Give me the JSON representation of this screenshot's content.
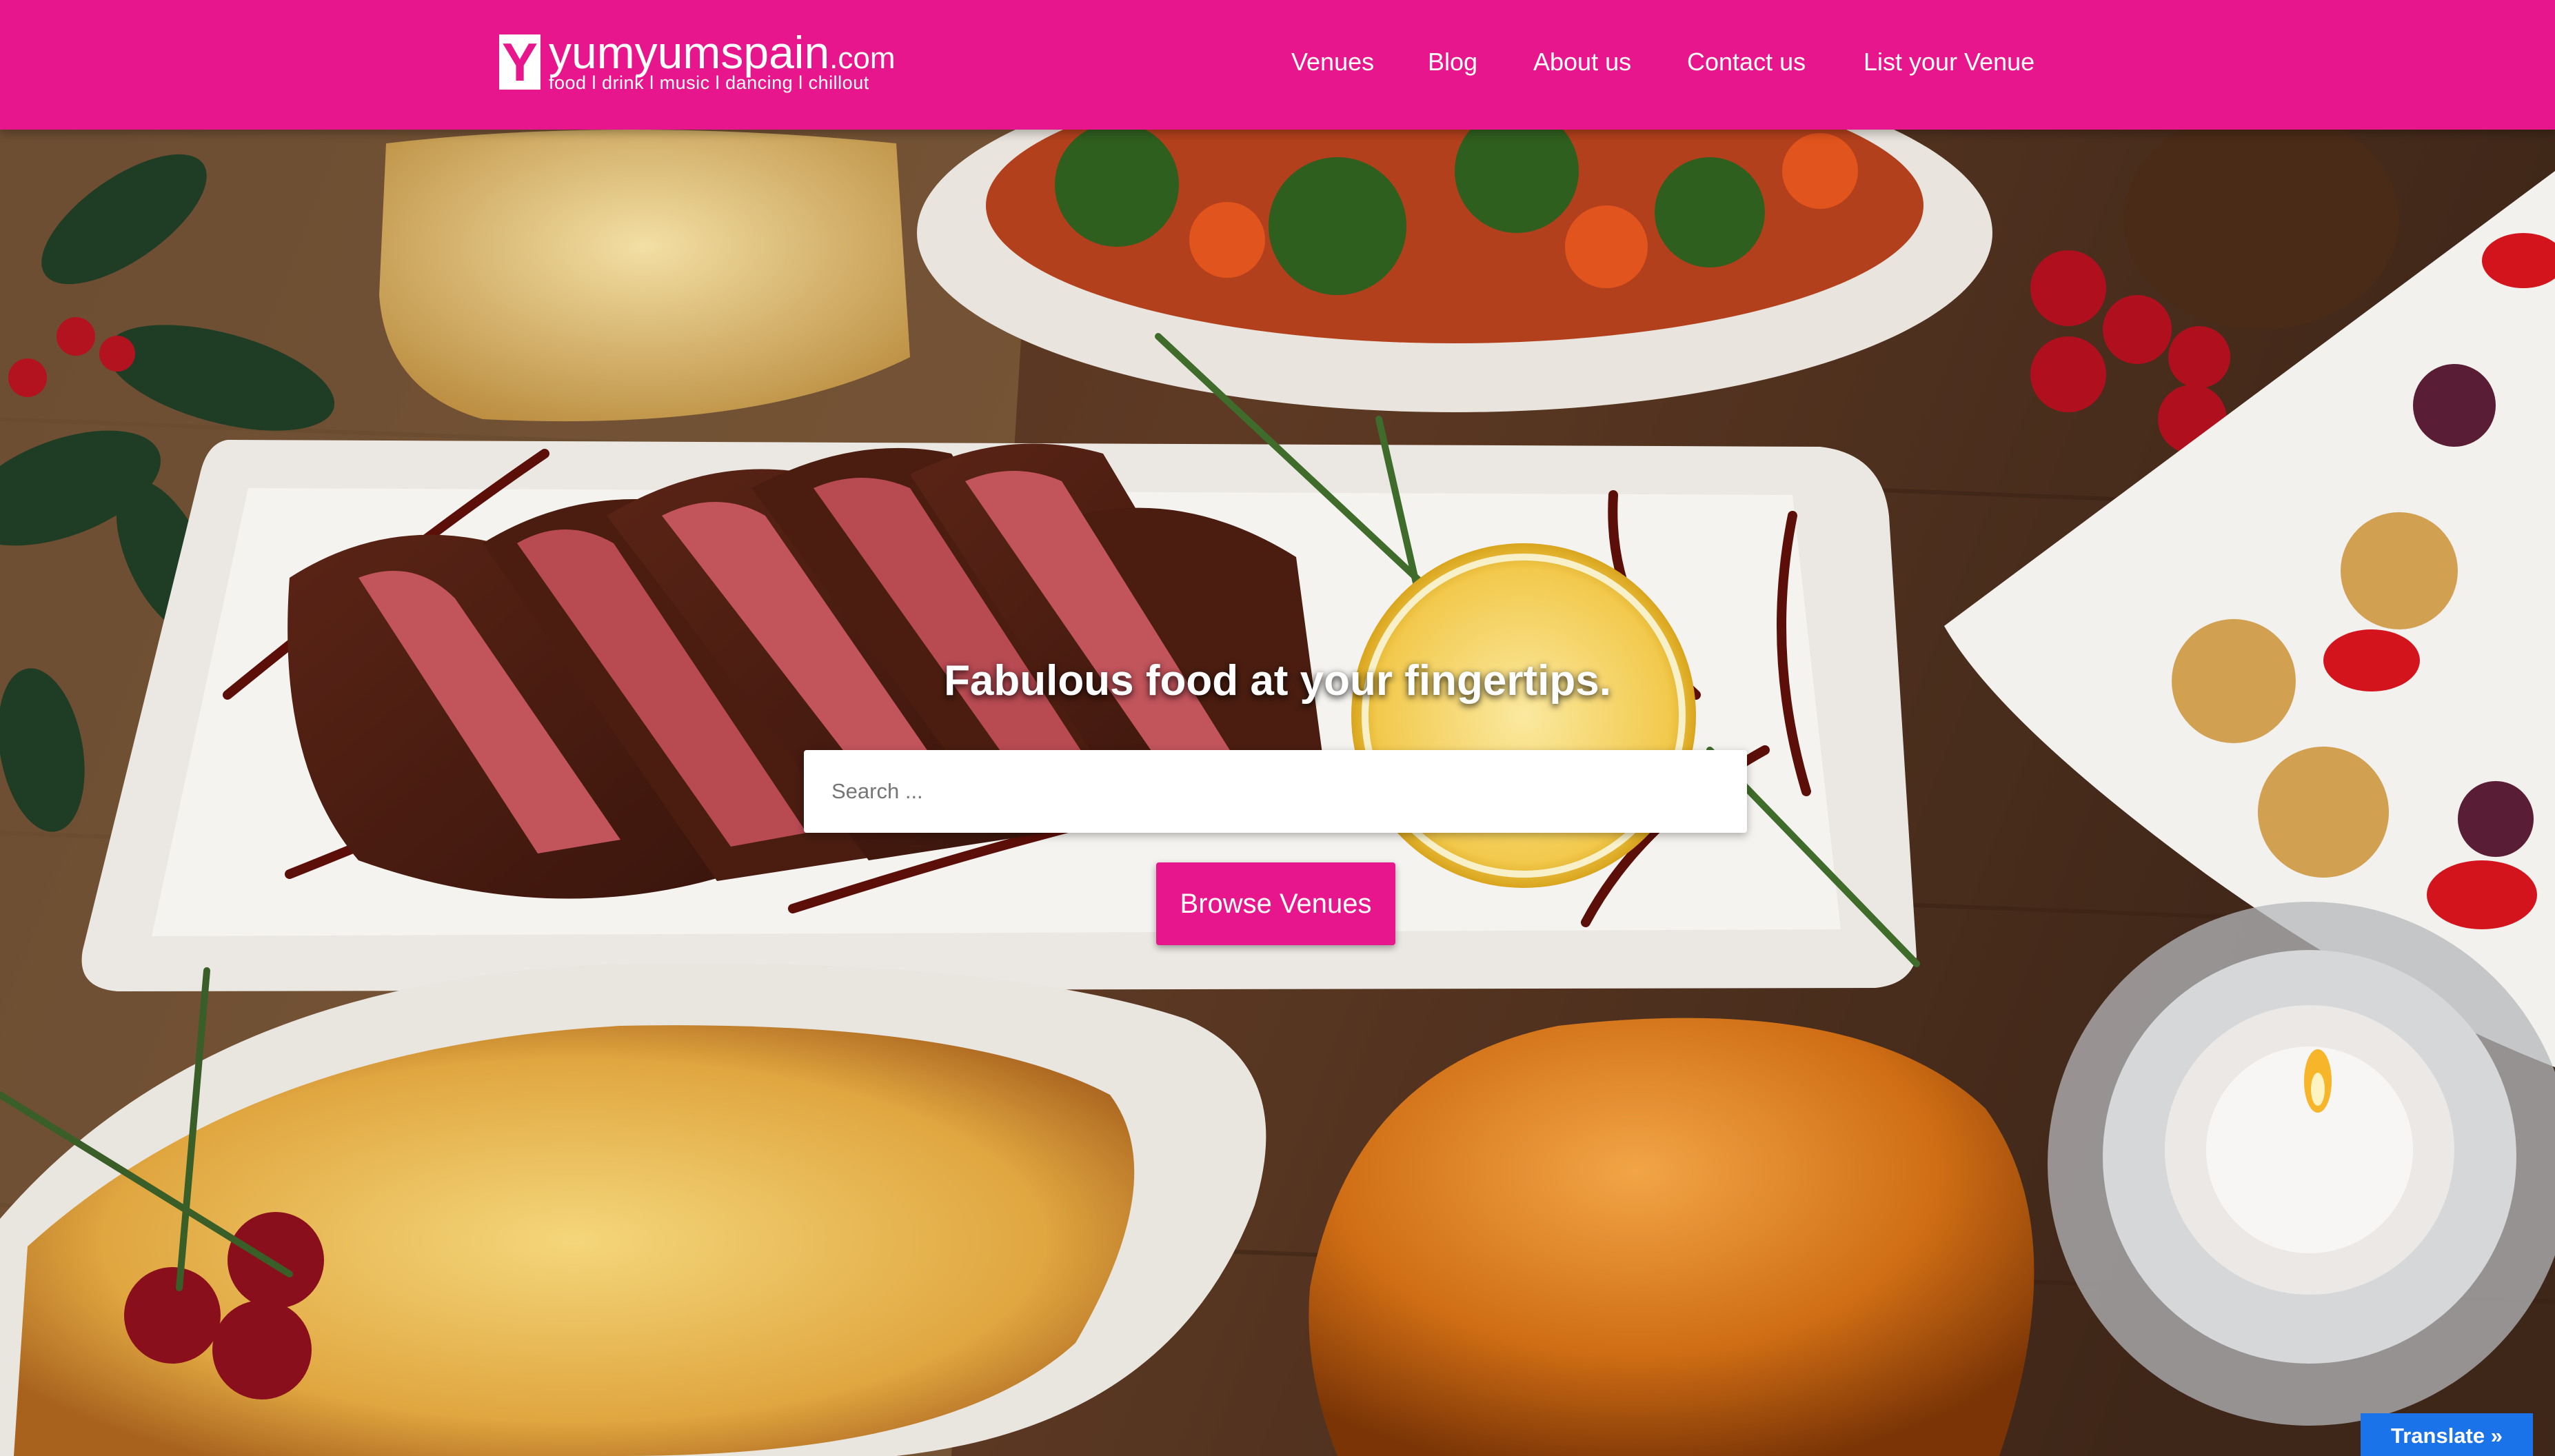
{
  "brand": {
    "logo_letter": "Y",
    "name": "yumyumspain",
    "tld": ".com",
    "tagline": "food  l drink  l music  l dancing  l chillout",
    "accent_color": "#e8168c"
  },
  "nav": {
    "items": [
      {
        "label": "Venues"
      },
      {
        "label": "Blog"
      },
      {
        "label": "About us"
      },
      {
        "label": "Contact us"
      },
      {
        "label": "List your Venue"
      }
    ]
  },
  "hero": {
    "headline": "Fabulous food at your fingertips.",
    "search": {
      "value": "",
      "placeholder": "Search ...",
      "icon": "none"
    },
    "cta_label": "Browse Venues",
    "background": "holiday dinner table photo"
  },
  "translate_widget": {
    "label": "Translate »",
    "color": "#1a73e8"
  }
}
